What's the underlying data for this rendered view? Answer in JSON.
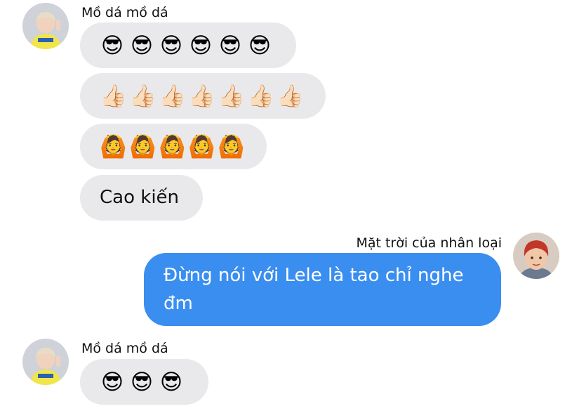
{
  "thread": {
    "group1": {
      "sender": "Mồ dá mồ dá",
      "rows": [
        {
          "emojis": [
            "😎",
            "😎",
            "😎",
            "😎",
            "😎",
            "😎"
          ],
          "icon": "cool-face-icon"
        },
        {
          "emojis": [
            "👍🏻",
            "👍🏻",
            "👍🏻",
            "👍🏻",
            "👍🏻",
            "👍🏻",
            "👍🏻"
          ],
          "icon": "thumbs-up-icon"
        },
        {
          "emojis": [
            "🙆",
            "🙆",
            "🙆",
            "🙆",
            "🙆"
          ],
          "icon": "ok-gesture-icon"
        }
      ],
      "text": "Cao kiến"
    },
    "group2": {
      "sender": "Mặt trời của nhân loại",
      "line1": "Đừng nói với Lele là tao chỉ nghe",
      "line2": "đm"
    },
    "group3": {
      "sender": "Mồ dá mồ dá",
      "emojis": [
        "😎",
        "😎",
        "😎"
      ]
    }
  },
  "colors": {
    "received_bubble": "#e9e9eb",
    "sent_bubble": "#3a8ef0"
  }
}
